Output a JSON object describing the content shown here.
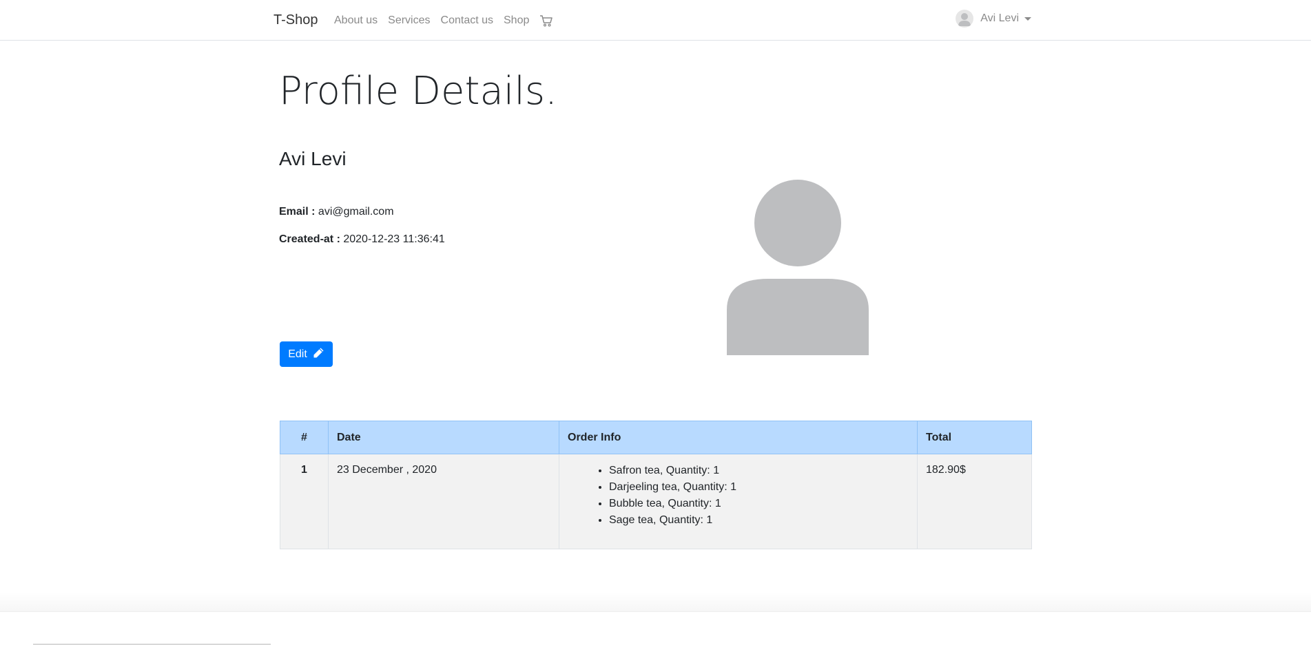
{
  "navbar": {
    "brand": "T-Shop",
    "links": [
      "About us",
      "Services",
      "Contact us",
      "Shop"
    ],
    "cart_icon": "shopping-cart-icon",
    "user": {
      "name": "Avi Levi",
      "avatar_icon": "user-avatar-icon"
    }
  },
  "profile": {
    "title": "Profile Details.",
    "name": "Avi Levi",
    "email_label": "Email :",
    "email": "avi@gmail.com",
    "created_label": "Created-at :",
    "created_at": "2020-12-23 11:36:41",
    "edit_label": "Edit",
    "edit_icon": "pencil-icon",
    "avatar_icon": "user-silhouette-icon"
  },
  "orders": {
    "headers": [
      "#",
      "Date",
      "Order Info",
      "Total"
    ],
    "rows": [
      {
        "num": "1",
        "date": "23 December , 2020",
        "items": [
          "Safron tea, Quantity: 1",
          "Darjeeling tea, Quantity: 1",
          "Bubble tea, Quantity: 1",
          "Sage tea, Quantity: 1"
        ],
        "total": "182.90$"
      }
    ]
  },
  "colors": {
    "primary": "#007bff",
    "table_header": "#b8daff",
    "row_bg": "#f2f2f2",
    "avatar_gray": "#bdbec0"
  }
}
